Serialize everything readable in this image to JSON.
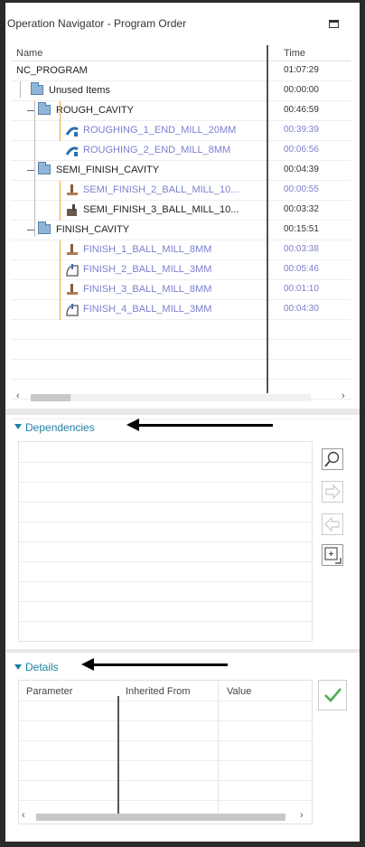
{
  "window": {
    "title": "Operation Navigator - Program Order"
  },
  "columns": {
    "name": "Name",
    "time": "Time"
  },
  "rows": [
    {
      "label": "NC_PROGRAM",
      "time": "01:07:29",
      "color": "dark",
      "icon": "none"
    },
    {
      "label": "Unused Items",
      "time": "00:00:00",
      "color": "dark",
      "icon": "folder-icon"
    },
    {
      "label": "ROUGH_CAVITY",
      "time": "00:46:59",
      "color": "dark",
      "icon": "folder-icon"
    },
    {
      "label": "ROUGHING_1_END_MILL_20MM",
      "time": "00:39:39",
      "color": "blue",
      "icon": "cavity-mill-icon"
    },
    {
      "label": "ROUGHING_2_END_MILL_8MM",
      "time": "00:06:56",
      "color": "blue",
      "icon": "cavity-mill-icon"
    },
    {
      "label": "SEMI_FINISH_CAVITY",
      "time": "00:04:39",
      "color": "dark",
      "icon": "folder-icon"
    },
    {
      "label": "SEMI_FINISH_2_BALL_MILL_10...",
      "time": "00:00:55",
      "color": "blue",
      "icon": "ball-mill-icon"
    },
    {
      "label": "SEMI_FINISH_3_BALL_MILL_10...",
      "time": "00:03:32",
      "color": "dark",
      "icon": "surface-mill-icon"
    },
    {
      "label": "FINISH_CAVITY",
      "time": "00:15:51",
      "color": "dark",
      "icon": "folder-icon"
    },
    {
      "label": "FINISH_1_BALL_MILL_8MM",
      "time": "00:03:38",
      "color": "blue",
      "icon": "ball-mill-icon"
    },
    {
      "label": "FINISH_2_BALL_MILL_3MM",
      "time": "00:05:46",
      "color": "blue",
      "icon": "contour-mill-icon"
    },
    {
      "label": "FINISH_3_BALL_MILL_8MM",
      "time": "00:01:10",
      "color": "blue",
      "icon": "ball-mill-icon"
    },
    {
      "label": "FINISH_4_BALL_MILL_3MM",
      "time": "00:04:30",
      "color": "blue",
      "icon": "contour-mill-icon"
    }
  ],
  "dependencies": {
    "title": "Dependencies"
  },
  "details": {
    "title": "Details",
    "columns": [
      "Parameter",
      "Inherited From",
      "Value"
    ]
  },
  "colors": {
    "accent": "#1f7fa5",
    "operation_blue": "#7b7fd0",
    "tree_line": "#e5a83a",
    "check_green": "#4caf50"
  }
}
